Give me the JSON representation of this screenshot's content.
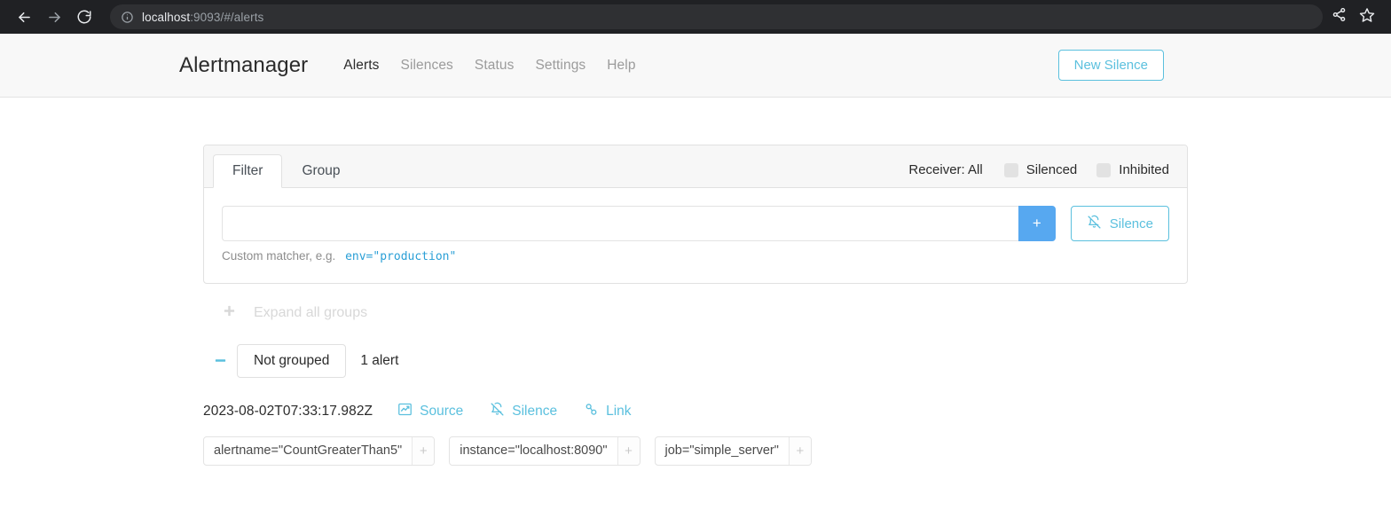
{
  "browser": {
    "back_icon": "back-arrow-icon",
    "forward_icon": "forward-arrow-icon",
    "reload_icon": "reload-icon",
    "info_icon": "info-circle-icon",
    "url_host": "localhost",
    "url_path": ":9093/#/alerts",
    "share_icon": "share-icon",
    "bookmark_icon": "star-icon"
  },
  "navbar": {
    "brand": "Alertmanager",
    "links": [
      {
        "label": "Alerts",
        "active": true
      },
      {
        "label": "Silences",
        "active": false
      },
      {
        "label": "Status",
        "active": false
      },
      {
        "label": "Settings",
        "active": false
      },
      {
        "label": "Help",
        "active": false
      }
    ],
    "new_silence_label": "New Silence"
  },
  "filter_card": {
    "tabs": [
      {
        "label": "Filter",
        "active": true
      },
      {
        "label": "Group",
        "active": false
      }
    ],
    "receiver_label": "Receiver: All",
    "toggles": [
      {
        "label": "Silenced",
        "checked": false
      },
      {
        "label": "Inhibited",
        "checked": false
      }
    ],
    "filter_input_value": "",
    "filter_input_placeholder": "",
    "add_button_label": "+",
    "silence_button_label": "Silence",
    "silence_button_icon": "bell-slash-icon",
    "hint_text": "Custom matcher, e.g.",
    "hint_code": "env=\"production\""
  },
  "expand_all": {
    "icon": "plus-icon",
    "label": "Expand all groups"
  },
  "group": {
    "collapse_icon": "minus-icon",
    "name": "Not grouped",
    "alert_count": "1 alert"
  },
  "alert": {
    "timestamp": "2023-08-02T07:33:17.982Z",
    "actions": [
      {
        "label": "Source",
        "icon": "chart-icon"
      },
      {
        "label": "Silence",
        "icon": "bell-slash-icon"
      },
      {
        "label": "Link",
        "icon": "link-icon"
      }
    ],
    "labels": [
      {
        "text": "alertname=\"CountGreaterThan5\"",
        "add": "+"
      },
      {
        "text": "instance=\"localhost:8090\"",
        "add": "+"
      },
      {
        "text": "job=\"simple_server\"",
        "add": "+"
      }
    ]
  },
  "colors": {
    "accent": "#5bc0de",
    "primary_button": "#57a8f0",
    "link": "#2a9fd6",
    "navbar_bg": "#f8f8f8",
    "chrome_bg": "#202124"
  }
}
